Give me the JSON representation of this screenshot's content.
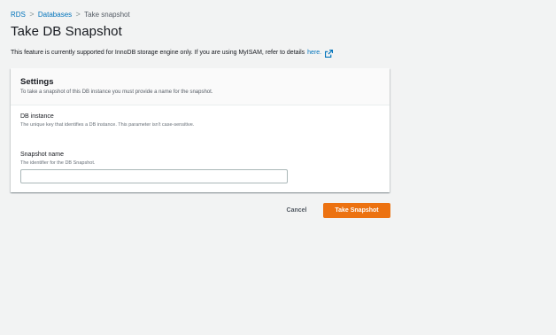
{
  "breadcrumb": {
    "items": [
      {
        "label": "RDS"
      },
      {
        "label": "Databases"
      },
      {
        "label": "Take snapshot"
      }
    ],
    "separator": ">"
  },
  "page": {
    "title": "Take DB Snapshot",
    "info_text": "This feature is currently supported for InnoDB storage engine only. If you are using MyISAM, refer to details",
    "info_link": "here."
  },
  "settings": {
    "title": "Settings",
    "description": "To take a snapshot of this DB instance you must provide a name for the snapshot.",
    "db_instance": {
      "label": "DB instance",
      "description": "The unique key that identifies a DB instance. This parameter isn't case-sensitive."
    },
    "snapshot_name": {
      "label": "Snapshot name",
      "description": "The identifier for the DB Snapshot.",
      "value": ""
    }
  },
  "actions": {
    "cancel_label": "Cancel",
    "submit_label": "Take Snapshot"
  },
  "colors": {
    "link": "#0073bb",
    "primary": "#ec7211",
    "background": "#f2f3f3"
  },
  "icons": [
    "external-link-icon"
  ]
}
